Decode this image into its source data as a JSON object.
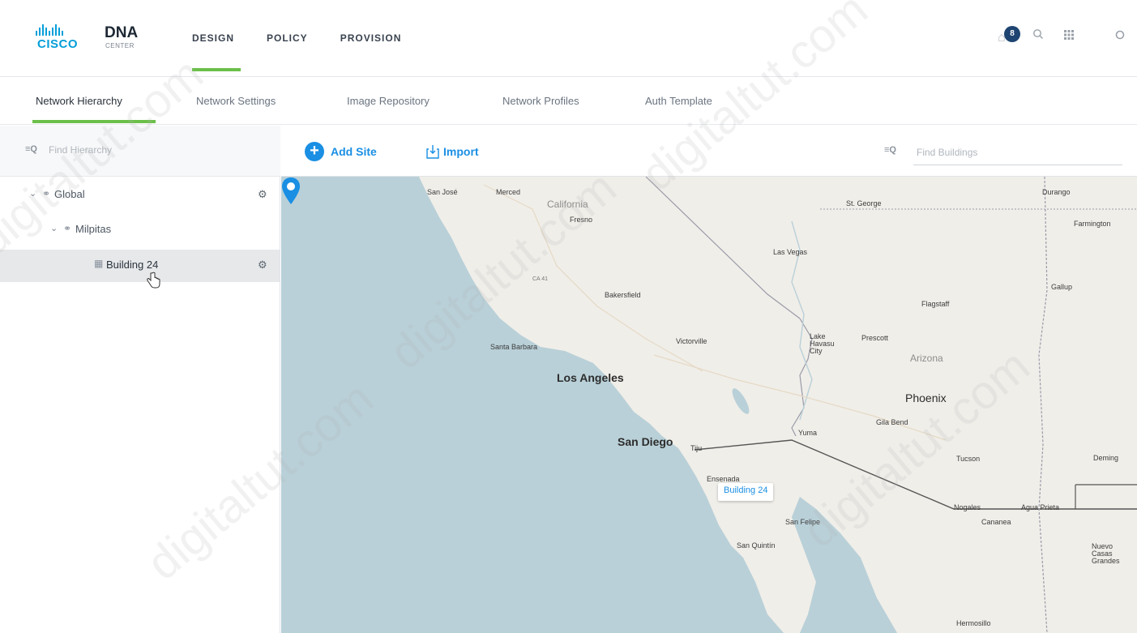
{
  "app": {
    "brand": "CISCO",
    "product": "DNA",
    "product_sub": "CENTER"
  },
  "nav": {
    "items": [
      {
        "label": "DESIGN",
        "active": true
      },
      {
        "label": "POLICY",
        "active": false
      },
      {
        "label": "PROVISION",
        "active": false
      }
    ]
  },
  "header": {
    "notification_count": "8",
    "icons": [
      "bell-icon",
      "search-icon",
      "apps-grid-icon",
      "more-icon"
    ]
  },
  "subtabs": {
    "items": [
      {
        "label": "Network Hierarchy",
        "active": true
      },
      {
        "label": "Network Settings",
        "active": false
      },
      {
        "label": "Image Repository",
        "active": false
      },
      {
        "label": "Network Profiles",
        "active": false
      },
      {
        "label": "Auth Template",
        "active": false
      }
    ]
  },
  "hierarchy": {
    "search_placeholder": "Find Hierarchy",
    "nodes": [
      {
        "label": "Global",
        "type": "area",
        "expanded": true,
        "level": 0
      },
      {
        "label": "Milpitas",
        "type": "area",
        "expanded": true,
        "level": 1
      },
      {
        "label": "Building 24",
        "type": "building",
        "selected": true,
        "level": 2
      }
    ]
  },
  "toolbar": {
    "add_site_label": "Add Site",
    "import_label": "Import",
    "find_buildings_placeholder": "Find Buildings"
  },
  "map": {
    "pin_label": "Building 24",
    "cities": [
      {
        "name": "San José"
      },
      {
        "name": "Merced"
      },
      {
        "name": "California"
      },
      {
        "name": "Fresno"
      },
      {
        "name": "St. George"
      },
      {
        "name": "Durango"
      },
      {
        "name": "Farmington"
      },
      {
        "name": "Las Vegas"
      },
      {
        "name": "CA 41"
      },
      {
        "name": "Bakersfield"
      },
      {
        "name": "Gallup"
      },
      {
        "name": "Flagstaff"
      },
      {
        "name": "Santa Barbara"
      },
      {
        "name": "Victorville"
      },
      {
        "name": "Lake Havasu City"
      },
      {
        "name": "Prescott"
      },
      {
        "name": "Arizona"
      },
      {
        "name": "Los Angeles"
      },
      {
        "name": "Phoenix"
      },
      {
        "name": "Gila Bend"
      },
      {
        "name": "Yuma"
      },
      {
        "name": "San Diego"
      },
      {
        "name": "Tiju"
      },
      {
        "name": "Tucson"
      },
      {
        "name": "Deming"
      },
      {
        "name": "Ensenada"
      },
      {
        "name": "Nogales"
      },
      {
        "name": "Agua Prieta"
      },
      {
        "name": "Cananea"
      },
      {
        "name": "San Felipe"
      },
      {
        "name": "San Quintín"
      },
      {
        "name": "Nuevo Casas Grandes"
      },
      {
        "name": "Hermosillo"
      }
    ]
  },
  "watermark": "digitaltut.com"
}
